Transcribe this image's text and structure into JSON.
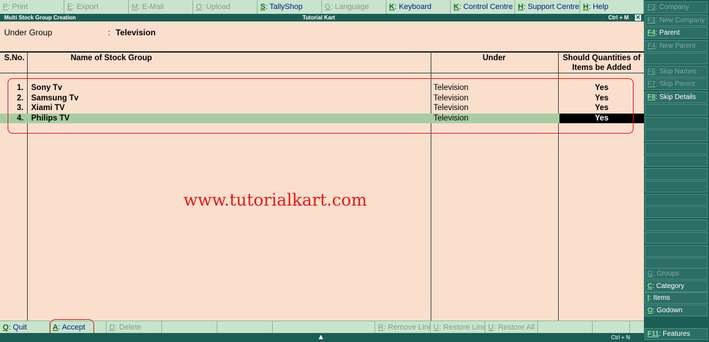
{
  "menu": [
    {
      "key": "P",
      "label": ": Print",
      "enabled": false
    },
    {
      "key": "E",
      "label": ": Export",
      "enabled": false
    },
    {
      "key": "M",
      "label": ": E-Mail",
      "enabled": false
    },
    {
      "key": "O",
      "label": ": Upload",
      "enabled": false
    },
    {
      "key": "S",
      "label": ": TallyShop",
      "enabled": true
    },
    {
      "key": "G",
      "label": ": Language",
      "enabled": false
    },
    {
      "key": "K",
      "label": ": Keyboard",
      "enabled": true
    },
    {
      "key": "K",
      "label": ": Control Centre",
      "enabled": true
    },
    {
      "key": "H",
      "label": ": Support Centre",
      "enabled": true
    },
    {
      "key": "H",
      "label": ": Help",
      "enabled": true
    }
  ],
  "titlebar": {
    "left": "Multi Stock Group Creation",
    "center": "Tutorial Kart",
    "right": "Ctrl + M",
    "close": "✕"
  },
  "form": {
    "under_label": "Under Group",
    "colon": ":",
    "under_value": "Television"
  },
  "table": {
    "headers": {
      "sno": "S.No.",
      "name": "Name of Stock Group",
      "under": "Under",
      "qty_line1": "Should Quantities of",
      "qty_line2": "Items be Added"
    },
    "rows": [
      {
        "sno": "1.",
        "name": "Sony Tv",
        "under": "Television",
        "qty": "Yes"
      },
      {
        "sno": "2.",
        "name": "Samsung Tv",
        "under": "Television",
        "qty": "Yes"
      },
      {
        "sno": "3.",
        "name": "Xiami TV",
        "under": "Television",
        "qty": "Yes"
      },
      {
        "sno": "4.",
        "name": "Philips TV",
        "under": "Television",
        "qty": "Yes"
      }
    ]
  },
  "watermark": "www.tutorialkart.com",
  "bottom": [
    {
      "key": "Q",
      "label": ": Quit",
      "enabled": true
    },
    {
      "key": "A",
      "label": ": Accept",
      "enabled": true
    },
    {
      "key": "D",
      "label": ": Delete",
      "enabled": false
    },
    {
      "key": "",
      "label": "",
      "enabled": false
    },
    {
      "key": "",
      "label": "",
      "enabled": false
    },
    {
      "key": "",
      "label": "",
      "enabled": false
    },
    {
      "key": "R",
      "label": ": Remove Line",
      "enabled": false
    },
    {
      "key": "U",
      "label": ": Restore Line",
      "enabled": false
    },
    {
      "key": "U",
      "label": ": Restore All",
      "enabled": false
    },
    {
      "key": "",
      "label": "",
      "enabled": false
    },
    {
      "key": "",
      "label": "",
      "enabled": false
    }
  ],
  "footer": {
    "caret": "▲",
    "right": "Ctrl + N"
  },
  "right_panel": [
    {
      "key": "F3",
      "label": ": Company",
      "enabled": false
    },
    {
      "key": "F3",
      "label": ": New Company",
      "enabled": false
    },
    {
      "key": "F4",
      "label": ": Parent",
      "enabled": true
    },
    {
      "key": "F4",
      "label": ": New Parent",
      "enabled": false
    },
    {
      "key": "",
      "label": "",
      "enabled": false
    },
    {
      "key": "F6",
      "label": ": Skip Names",
      "enabled": false
    },
    {
      "key": "F7",
      "label": ": Skip Parent",
      "enabled": false
    },
    {
      "key": "F8",
      "label": ": Skip Details",
      "enabled": true
    }
  ],
  "right_panel_bottom": [
    {
      "key": "G",
      "label": ": Groups",
      "enabled": false
    },
    {
      "key": "C",
      "label": ": Category",
      "enabled": true
    },
    {
      "key": "I",
      "label": ": Items",
      "enabled": true
    },
    {
      "key": "O",
      "label": ": Godown",
      "enabled": true
    }
  ],
  "features": {
    "key": "F11",
    "label": ": Features"
  },
  "colors": {
    "menu_bg": "#c8e4cc",
    "title_bg": "#1b5e56",
    "content_bg": "#fbdfcd",
    "selected_row": "#a6cda2",
    "highlight": "#e0191b"
  }
}
